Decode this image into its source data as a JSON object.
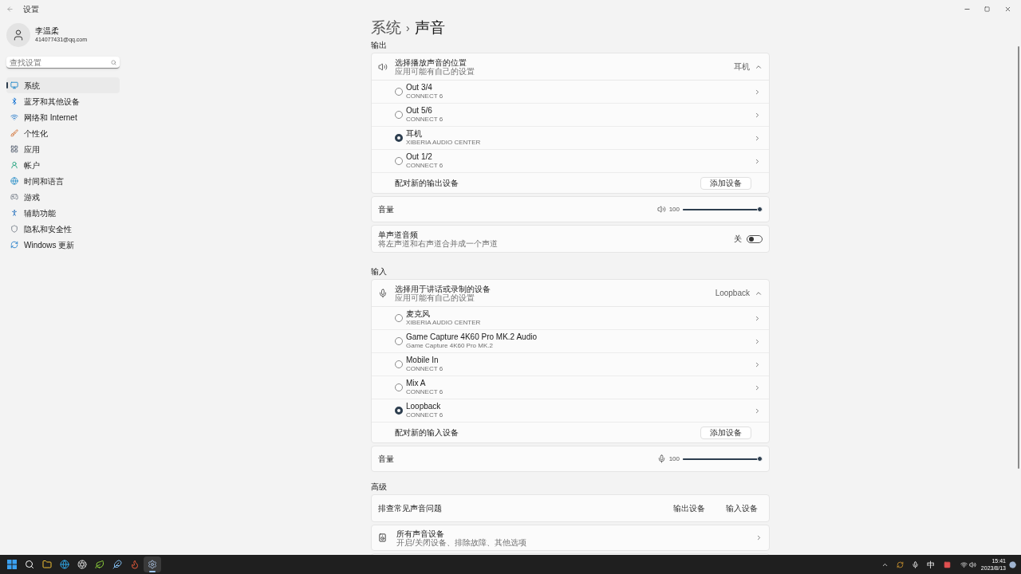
{
  "window": {
    "title": "设置"
  },
  "user": {
    "name": "李温柔",
    "email": "414077431@qq.com"
  },
  "search": {
    "placeholder": "查找设置"
  },
  "nav": [
    {
      "label": "系统",
      "selected": true
    },
    {
      "label": "蓝牙和其他设备",
      "selected": false
    },
    {
      "label": "网络和 Internet",
      "selected": false
    },
    {
      "label": "个性化",
      "selected": false
    },
    {
      "label": "应用",
      "selected": false
    },
    {
      "label": "帐户",
      "selected": false
    },
    {
      "label": "时间和语言",
      "selected": false
    },
    {
      "label": "游戏",
      "selected": false
    },
    {
      "label": "辅助功能",
      "selected": false
    },
    {
      "label": "隐私和安全性",
      "selected": false
    },
    {
      "label": "Windows 更新",
      "selected": false
    }
  ],
  "breadcrumb": {
    "parent": "系统",
    "separator": "›",
    "current": "声音"
  },
  "output": {
    "heading": "输出",
    "selector": {
      "title": "选择播放声音的位置",
      "subtitle": "应用可能有自己的设置",
      "value": "耳机",
      "expanded": true
    },
    "devices": [
      {
        "name": "Out 3/4",
        "detail": "CONNECT 6",
        "selected": false
      },
      {
        "name": "Out 5/6",
        "detail": "CONNECT 6",
        "selected": false
      },
      {
        "name": "耳机",
        "detail": "XIBERIA AUDIO CENTER",
        "selected": true
      },
      {
        "name": "Out 1/2",
        "detail": "CONNECT 6",
        "selected": false
      }
    ],
    "pair": {
      "label": "配对新的输出设备",
      "button": "添加设备"
    },
    "volume": {
      "label": "音量",
      "reading": "100",
      "level": 1
    },
    "mono": {
      "title": "单声道音频",
      "subtitle": "将左声道和右声道合并成一个声道",
      "state": "关",
      "on": false
    }
  },
  "input": {
    "heading": "输入",
    "selector": {
      "title": "选择用于讲话或录制的设备",
      "subtitle": "应用可能有自己的设置",
      "value": "Loopback",
      "expanded": true
    },
    "devices": [
      {
        "name": "麦克风",
        "detail": "XIBERIA AUDIO CENTER",
        "selected": false
      },
      {
        "name": "Game Capture 4K60 Pro MK.2 Audio",
        "detail": "Game Capture 4K60 Pro MK.2",
        "selected": false
      },
      {
        "name": "Mobile In",
        "detail": "CONNECT 6",
        "selected": false
      },
      {
        "name": "Mix A",
        "detail": "CONNECT 6",
        "selected": false
      },
      {
        "name": "Loopback",
        "detail": "CONNECT 6",
        "selected": true
      }
    ],
    "pair": {
      "label": "配对新的输入设备",
      "button": "添加设备"
    },
    "volume": {
      "label": "音量",
      "reading": "100",
      "level": 1
    }
  },
  "advanced": {
    "heading": "高级",
    "troubleshoot": {
      "label": "排查常见声音问题",
      "links": [
        "输出设备",
        "输入设备"
      ]
    },
    "all_devices": {
      "title": "所有声音设备",
      "subtitle": "开启/关闭设备、排除故障、其他选项"
    }
  },
  "taskbar": {
    "apps": [
      {
        "selected": false
      },
      {
        "selected": false
      },
      {
        "selected": false
      },
      {
        "selected": false
      },
      {
        "selected": false
      },
      {
        "selected": false
      },
      {
        "selected": false
      },
      {
        "selected": false
      },
      {
        "selected": true
      }
    ],
    "ime": "中",
    "time": "15:41",
    "date": "2023/8/13"
  }
}
